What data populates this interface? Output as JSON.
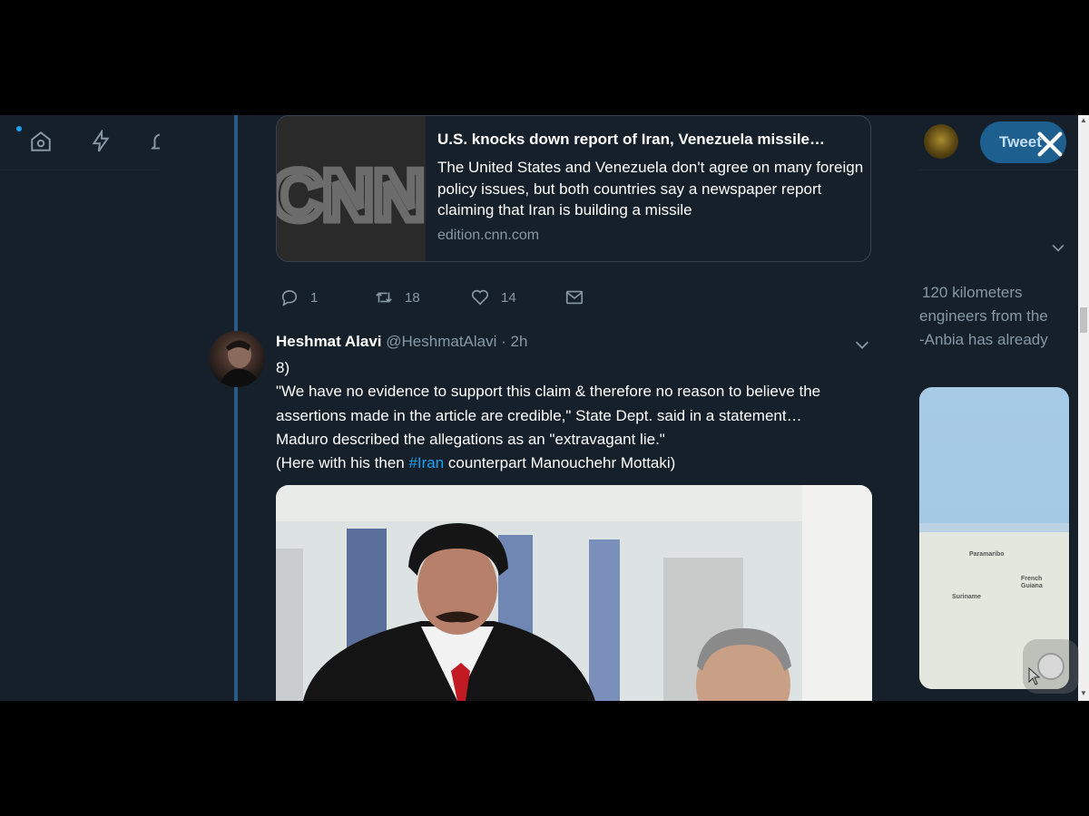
{
  "topbar": {
    "icons": [
      "home-icon",
      "moments-icon",
      "notifications-icon"
    ],
    "tweet_button_label": "Tweet",
    "close_icon": "close-icon"
  },
  "sidebar": {
    "lines": [
      "120 kilometers",
      "engineers from the",
      "-Anbia has already"
    ],
    "map_labels": [
      "Paramaribo",
      "Suriname",
      "French Guiana"
    ]
  },
  "card": {
    "thumb_text": "CNN",
    "title": "U.S. knocks down report of Iran, Venezuela missile…",
    "description": "The United States and Venezuela don't agree on many foreign policy issues, but both countries say a newspaper report claiming that Iran is building a missile",
    "domain": "edition.cnn.com"
  },
  "actions": {
    "reply_count": "1",
    "retweet_count": "18",
    "like_count": "14"
  },
  "tweet": {
    "name": "Heshmat Alavi",
    "handle": "@HeshmatAlavi",
    "separator": " · ",
    "time": "2h",
    "lines": [
      "8)",
      "\"We have no evidence to support this claim & therefore no reason to believe the",
      "assertions made in the article are credible,\" State Dept. said in a statement…",
      "Maduro described the allegations as an \"extravagant lie.\""
    ],
    "last_line_before": "(Here with his then ",
    "hashtag": "#Iran",
    "last_line_after": " counterpart Manouchehr Mottaki)"
  },
  "colors": {
    "background": "#15202b",
    "accent": "#1da1f2",
    "muted": "#8899a6",
    "thread_line": "#2b5b85"
  }
}
